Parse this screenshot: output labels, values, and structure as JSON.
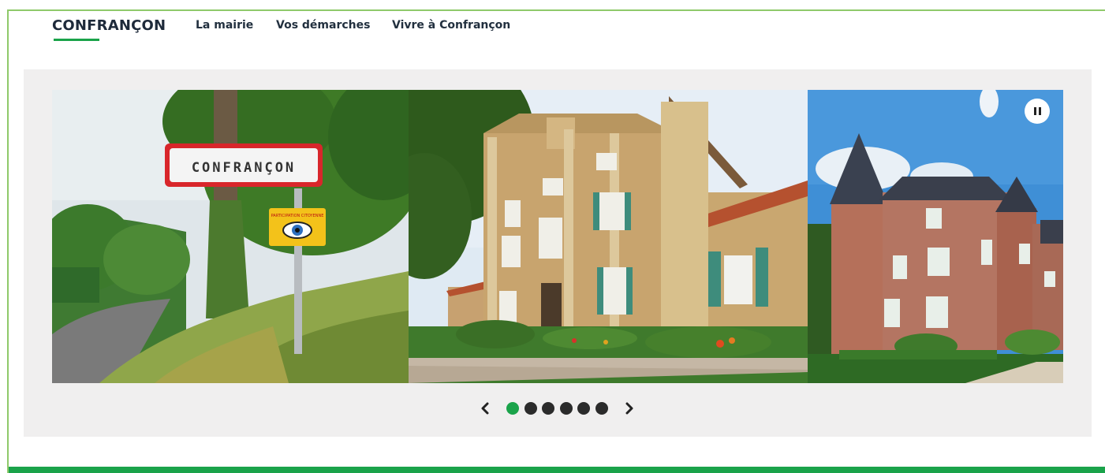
{
  "site": {
    "brand": "CONFRANÇON",
    "accent_color": "#1aa34a",
    "frame_color": "#8fc96a"
  },
  "nav": {
    "items": [
      {
        "label": "La mairie"
      },
      {
        "label": "Vos démarches"
      },
      {
        "label": "Vivre à Confrançon"
      }
    ]
  },
  "carousel": {
    "slides": [
      {
        "subject": "village-entrance-sign",
        "sign_text": "CONFRANÇON",
        "small_sign_text": "PARTICIPATION CITOYENNE"
      },
      {
        "subject": "town-hall-building"
      },
      {
        "subject": "chateau"
      }
    ],
    "dots_count": 6,
    "active_dot": 0,
    "prev_icon": "chevron-left-icon",
    "next_icon": "chevron-right-icon",
    "pause_icon": "pause-icon"
  }
}
